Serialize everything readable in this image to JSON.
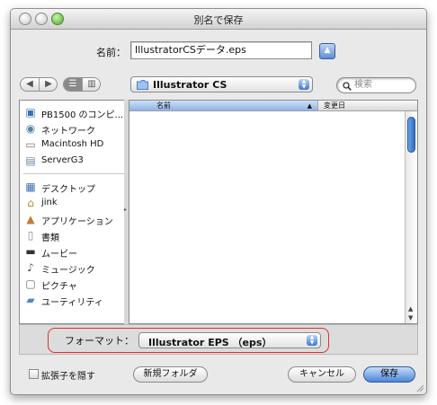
{
  "window": {
    "title": "別名で保存"
  },
  "name_row": {
    "label": "名前：",
    "value": "IllustratorCSデータ.eps"
  },
  "toolbar": {
    "back_glyph": "◀",
    "forward_glyph": "▶",
    "list_view_glyph": "☰",
    "column_view_glyph": "▥",
    "location": "Illustrator CS",
    "search_placeholder": "検索"
  },
  "sidebar": {
    "devices": [
      {
        "icon": "computer-icon",
        "label": "PB1500 のコンピ..."
      },
      {
        "icon": "network-icon",
        "label": "ネットワーク"
      },
      {
        "icon": "hard-disk-icon",
        "label": "Macintosh HD"
      },
      {
        "icon": "server-icon",
        "label": "ServerG3"
      }
    ],
    "places": [
      {
        "icon": "desktop-icon",
        "label": "デスクトップ"
      },
      {
        "icon": "home-icon",
        "label": "jink"
      },
      {
        "icon": "applications-icon",
        "label": "アプリケーション"
      },
      {
        "icon": "documents-icon",
        "label": "書類"
      },
      {
        "icon": "movies-icon",
        "label": "ムービー"
      },
      {
        "icon": "music-icon",
        "label": "ミュージック"
      },
      {
        "icon": "pictures-icon",
        "label": "ピクチャ"
      },
      {
        "icon": "utilities-icon",
        "label": "ユーティリティ"
      }
    ]
  },
  "browser": {
    "col_name": "名前",
    "col_modified": "変更日"
  },
  "format": {
    "label": "フォーマット：",
    "value": "Illustrator EPS （eps）"
  },
  "footer": {
    "hide_extension": "拡張子を隠す",
    "new_folder": "新規フォルダ",
    "cancel": "キャンセル",
    "save": "保存"
  },
  "colors": {
    "accent": "#4c86d8",
    "highlight_outline": "#d4322c"
  }
}
